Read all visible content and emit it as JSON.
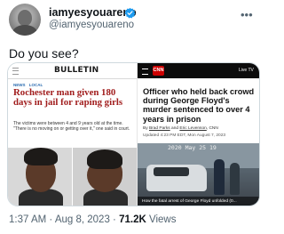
{
  "author": {
    "display_name": "iamyesyouareno",
    "handle": "@iamyesyouareno",
    "verified_icon": "verified-badge-icon",
    "verified_color": "#1d9bf0"
  },
  "tweet": {
    "text": "Do you see?",
    "time": "1:37 AM",
    "separator": "·",
    "date": "Aug 8, 2023",
    "views": "71.2K",
    "views_label": "Views"
  },
  "media_left": {
    "publication": "BULLETIN",
    "nav": "NEWS LOCAL",
    "headline": "Rochester man given 180 days in jail for raping girls",
    "body": "The victims were between 4 and 9 years old at the time. \"There is no moving on or getting over it,\" one said in court.",
    "headline_color": "#a11d1d"
  },
  "media_right": {
    "logo": "CNN",
    "live_tv": "Live TV",
    "headline": "Officer who held back crowd during George Floyd's murder sentenced to over 4 years in prison",
    "by_prefix": "By",
    "author_1": "Brad Parks",
    "and": "and",
    "author_2": "Eric Levenson",
    "outlet": ", CNN",
    "updated": "Updated 4:23 PM EDT, Mon August 7, 2023",
    "video_timestamp": "2020 May 25 19",
    "video_caption": "How the fatal arrest of George Floyd unfolded (0...",
    "brand_color": "#cc0000"
  }
}
